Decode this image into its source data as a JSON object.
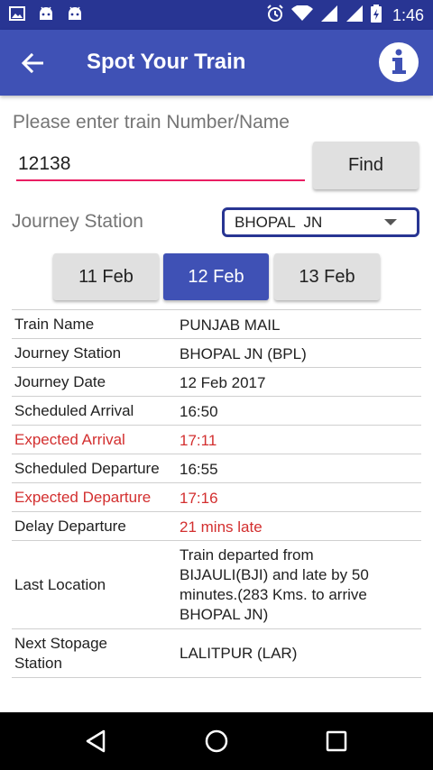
{
  "status_bar": {
    "time": "1:46",
    "left_icons": [
      "gallery-icon",
      "android-icon",
      "android-icon"
    ],
    "right_icons": [
      "alarm-icon",
      "wifi-icon",
      "signal-icon",
      "signal-icon",
      "battery-icon"
    ]
  },
  "app_bar": {
    "title": "Spot Your Train"
  },
  "search": {
    "prompt": "Please enter train Number/Name",
    "value": "12138",
    "find_label": "Find"
  },
  "journey": {
    "label": "Journey Station",
    "selected": "BHOPAL  JN"
  },
  "dates": [
    {
      "label": "11 Feb",
      "selected": false
    },
    {
      "label": "12 Feb",
      "selected": true
    },
    {
      "label": "13 Feb",
      "selected": false
    }
  ],
  "details": [
    {
      "label": "Train Name",
      "value": "PUNJAB MAIL",
      "highlight": false
    },
    {
      "label": "Journey Station",
      "value": "BHOPAL  JN (BPL)",
      "highlight": false
    },
    {
      "label": "Journey Date",
      "value": "12 Feb 2017",
      "highlight": false
    },
    {
      "label": "Scheduled Arrival",
      "value": "16:50",
      "highlight": false
    },
    {
      "label": "Expected Arrival",
      "value": "17:11",
      "highlight": true
    },
    {
      "label": "Scheduled Departure",
      "value": "16:55",
      "highlight": false
    },
    {
      "label": "Expected Departure",
      "value": "17:16",
      "highlight": true
    },
    {
      "label": "Delay Departure",
      "value": "21 mins late",
      "highlight": false,
      "value_highlight": true
    },
    {
      "label": "Last Location",
      "value": "Train departed from\nBIJAULI(BJI) and late by 50\nminutes.(283 Kms. to arrive\nBHOPAL  JN)",
      "highlight": false
    },
    {
      "label": "Next Stopage\nStation",
      "value": "LALITPUR (LAR)",
      "highlight": false
    }
  ],
  "colors": {
    "primary": "#3f51b5",
    "primary_dark": "#283593",
    "accent": "#e91e63",
    "alert": "#d32f2f"
  },
  "nav_bar": [
    "back-triangle-icon",
    "home-circle-icon",
    "recents-square-icon"
  ]
}
